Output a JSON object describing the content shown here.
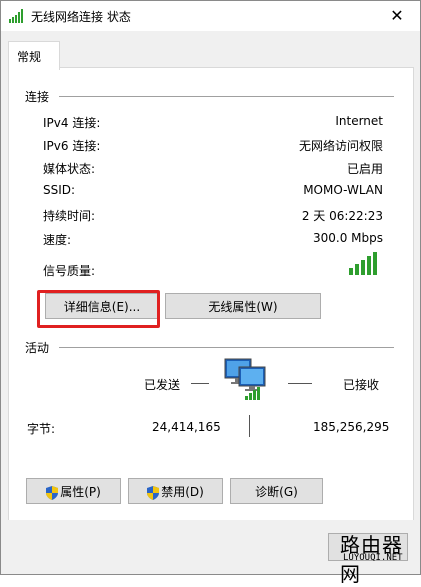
{
  "window": {
    "title": "无线网络连接 状态",
    "close_symbol": "✕"
  },
  "tabs": [
    {
      "label": "常规"
    }
  ],
  "connection": {
    "section_label": "连接",
    "rows": [
      {
        "label": "IPv4 连接:",
        "value": "Internet"
      },
      {
        "label": "IPv6 连接:",
        "value": "无网络访问权限"
      },
      {
        "label": "媒体状态:",
        "value": "已启用"
      },
      {
        "label": "SSID:",
        "value": "MOMO-WLAN"
      },
      {
        "label": "持续时间:",
        "value": "2 天 06:22:23"
      },
      {
        "label": "速度:",
        "value": "300.0 Mbps"
      },
      {
        "label": "信号质量:",
        "value": ""
      }
    ],
    "signal_bars": 5,
    "details_button": "详细信息(E)...",
    "wireless_props_button": "无线属性(W)"
  },
  "activity": {
    "section_label": "活动",
    "sent_label": "已发送",
    "received_label": "已接收",
    "bytes_label": "字节:",
    "bytes_sent": "24,414,165",
    "bytes_received": "185,256,295"
  },
  "buttons": {
    "properties": "属性(P)",
    "disable": "禁用(D)",
    "diagnose": "诊断(G)"
  },
  "watermark": {
    "main": "路由器网",
    "sub": "LUYOUQI.NET"
  },
  "colors": {
    "signal_green": "#2e9e2e",
    "highlight_red": "#e02020"
  }
}
